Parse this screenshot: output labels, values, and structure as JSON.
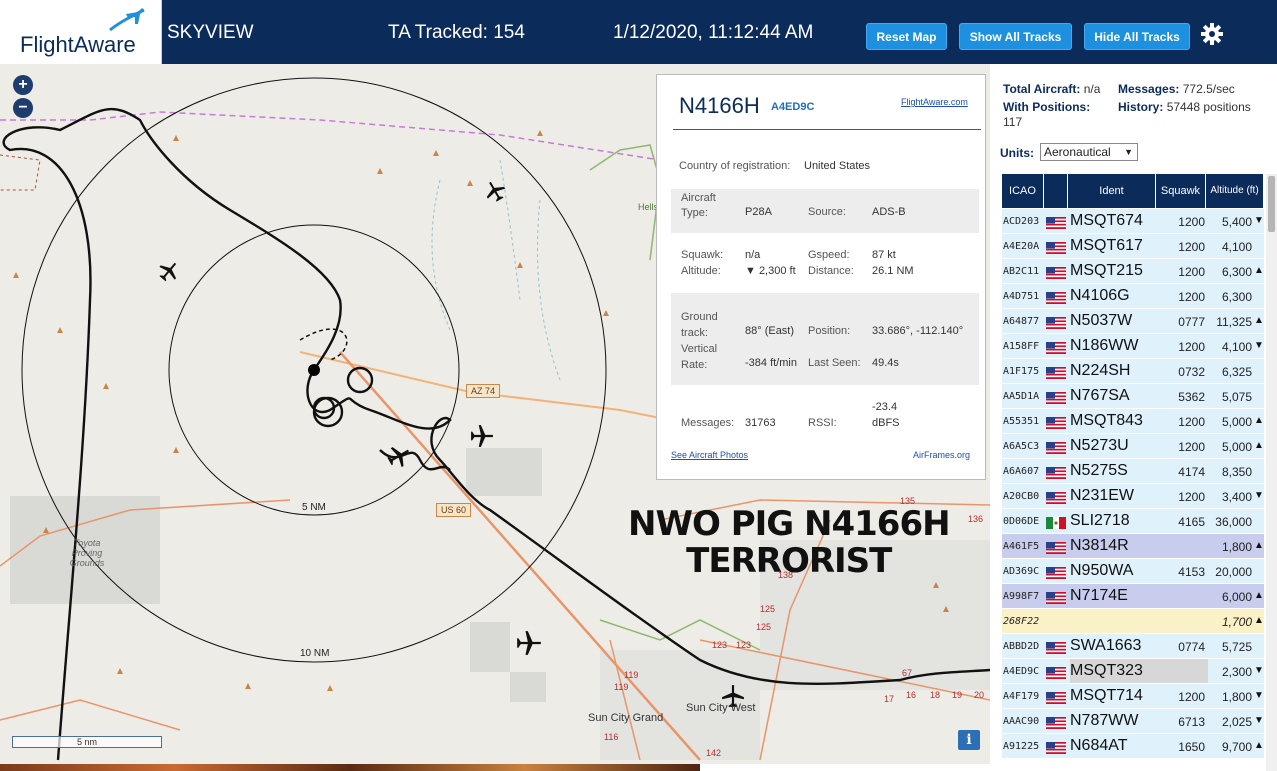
{
  "header": {
    "logo": "FlightAware",
    "app_name": "SKYVIEW",
    "ta_tracked": "TA Tracked: 154",
    "datetime": "1/12/2020, 11:12:44 AM",
    "reset_map": "Reset Map",
    "show_all_tracks": "Show All Tracks",
    "hide_all_tracks": "Hide All Tracks",
    "settings_icon": "gear-icon"
  },
  "map": {
    "zoom_in": "+",
    "zoom_out": "−",
    "ring_5nm": "5 NM",
    "ring_10nm": "10 NM",
    "road_az74": "AZ 74",
    "road_us60": "US 60",
    "place_sun_city_grand": "Sun City Grand",
    "place_sun_city_west": "Sun City West",
    "place_toyota": "Toyota Proving Grounds",
    "place_hells": "Hells Wil",
    "road_nums": [
      "135",
      "136",
      "125",
      "125",
      "123",
      "123",
      "119",
      "119",
      "116",
      "142",
      "17",
      "16",
      "18",
      "19",
      "20",
      "67",
      "138"
    ],
    "graffiti_line1": "NWO PIG N4166H",
    "graffiti_line2": "TERRORIST",
    "scale": "5 nm",
    "info_icon": "i"
  },
  "popup": {
    "callsign": "N4166H",
    "icao": "A4ED9C",
    "fa_link": "FlightAware.com",
    "country_label": "Country of registration:",
    "country_value": "United States",
    "aircraft_type_label": "Aircraft Type:",
    "aircraft_type_value": "P28A",
    "source_label": "Source:",
    "source_value": "ADS-B",
    "squawk_label": "Squawk:",
    "squawk_value": "n/a",
    "gspeed_label": "Gspeed:",
    "gspeed_value": "87 kt",
    "altitude_label": "Altitude:",
    "altitude_value": "▼ 2,300 ft",
    "distance_label": "Distance:",
    "distance_value": "26.1 NM",
    "ground_track_label": "Ground track:",
    "ground_track_value": "88° (East)",
    "position_label": "Position:",
    "position_value": "33.686°, -112.140°",
    "vertical_rate_label": "Vertical Rate:",
    "vertical_rate_value": "-384 ft/min",
    "last_seen_label": "Last Seen:",
    "last_seen_value": "49.4s",
    "messages_label": "Messages:",
    "messages_value": "31763",
    "rssi_label": "RSSI:",
    "rssi_value_line1": "-23.4",
    "rssi_value_line2": "dBFS",
    "see_photos": "See Aircraft Photos",
    "airframes": "AirFrames.org"
  },
  "sidebar": {
    "total_label": "Total Aircraft:",
    "total_value": "n/a",
    "messages_label": "Messages:",
    "messages_value": "772.5/sec",
    "with_pos_label": "With Positions:",
    "with_pos_value": "117",
    "history_label": "History:",
    "history_value": "57448 positions",
    "units_label": "Units:",
    "units_value": "Aeronautical",
    "columns": [
      "ICAO",
      "",
      "Ident",
      "Squawk",
      "Altitude (ft)"
    ],
    "rows": [
      {
        "icao": "ACD203",
        "flag": "US",
        "ident": "MSQT674",
        "squawk": "1200",
        "alt": "5,400",
        "arrow": "▼",
        "style": ""
      },
      {
        "icao": "A4E20A",
        "flag": "US",
        "ident": "MSQT617",
        "squawk": "1200",
        "alt": "4,100",
        "arrow": "",
        "style": ""
      },
      {
        "icao": "AB2C11",
        "flag": "US",
        "ident": "MSQT215",
        "squawk": "1200",
        "alt": "6,300",
        "arrow": "▲",
        "style": ""
      },
      {
        "icao": "A4D751",
        "flag": "US",
        "ident": "N4106G",
        "squawk": "1200",
        "alt": "6,300",
        "arrow": "",
        "style": ""
      },
      {
        "icao": "A64877",
        "flag": "US",
        "ident": "N5037W",
        "squawk": "0777",
        "alt": "11,325",
        "arrow": "▲",
        "style": ""
      },
      {
        "icao": "A158FF",
        "flag": "US",
        "ident": "N186WW",
        "squawk": "1200",
        "alt": "4,100",
        "arrow": "▼",
        "style": ""
      },
      {
        "icao": "A1F175",
        "flag": "US",
        "ident": "N224SH",
        "squawk": "0732",
        "alt": "6,325",
        "arrow": "",
        "style": ""
      },
      {
        "icao": "AA5D1A",
        "flag": "US",
        "ident": "N767SA",
        "squawk": "5362",
        "alt": "5,075",
        "arrow": "",
        "style": ""
      },
      {
        "icao": "A55351",
        "flag": "US",
        "ident": "MSQT843",
        "squawk": "1200",
        "alt": "5,000",
        "arrow": "▲",
        "style": ""
      },
      {
        "icao": "A6A5C3",
        "flag": "US",
        "ident": "N5273U",
        "squawk": "1200",
        "alt": "5,000",
        "arrow": "▲",
        "style": ""
      },
      {
        "icao": "A6A607",
        "flag": "US",
        "ident": "N5275S",
        "squawk": "4174",
        "alt": "8,350",
        "arrow": "",
        "style": ""
      },
      {
        "icao": "A20CB0",
        "flag": "US",
        "ident": "N231EW",
        "squawk": "1200",
        "alt": "3,400",
        "arrow": "▼",
        "style": ""
      },
      {
        "icao": "0D06DE",
        "flag": "MX",
        "ident": "SLI2718",
        "squawk": "4165",
        "alt": "36,000",
        "arrow": "",
        "style": ""
      },
      {
        "icao": "A461F5",
        "flag": "US",
        "ident": "N3814R",
        "squawk": "",
        "alt": "1,800",
        "arrow": "▲",
        "style": "sel"
      },
      {
        "icao": "AD369C",
        "flag": "US",
        "ident": "N950WA",
        "squawk": "4153",
        "alt": "20,000",
        "arrow": "",
        "style": ""
      },
      {
        "icao": "A998F7",
        "flag": "US",
        "ident": "N7174E",
        "squawk": "",
        "alt": "6,000",
        "arrow": "▲",
        "style": "sel"
      },
      {
        "icao": "268F22",
        "flag": "",
        "ident": "",
        "squawk": "",
        "alt": "1,700",
        "arrow": "▲",
        "style": "yel"
      },
      {
        "icao": "ABBD2D",
        "flag": "US",
        "ident": "SWA1663",
        "squawk": "0774",
        "alt": "5,725",
        "arrow": "",
        "style": ""
      },
      {
        "icao": "A4ED9C",
        "flag": "US",
        "ident": "MSQT323",
        "squawk": "",
        "alt": "2,300",
        "arrow": "▼",
        "style": "grey"
      },
      {
        "icao": "A4F179",
        "flag": "US",
        "ident": "MSQT714",
        "squawk": "1200",
        "alt": "1,800",
        "arrow": "▼",
        "style": ""
      },
      {
        "icao": "AAAC90",
        "flag": "US",
        "ident": "N787WW",
        "squawk": "6713",
        "alt": "2,025",
        "arrow": "▼",
        "style": ""
      },
      {
        "icao": "A91225",
        "flag": "US",
        "ident": "N684AT",
        "squawk": "1650",
        "alt": "9,700",
        "arrow": "▲",
        "style": ""
      }
    ]
  },
  "colors": {
    "header_bg": "#0b2b5a",
    "button_bg": "#1e90e0",
    "row_bg": "#dff1fb",
    "row_selected": "#c8cdee",
    "row_yellow": "#faf2c6",
    "track": "#111111",
    "road_orange": "#e8956a",
    "boundary_purple": "#c77ad8"
  }
}
